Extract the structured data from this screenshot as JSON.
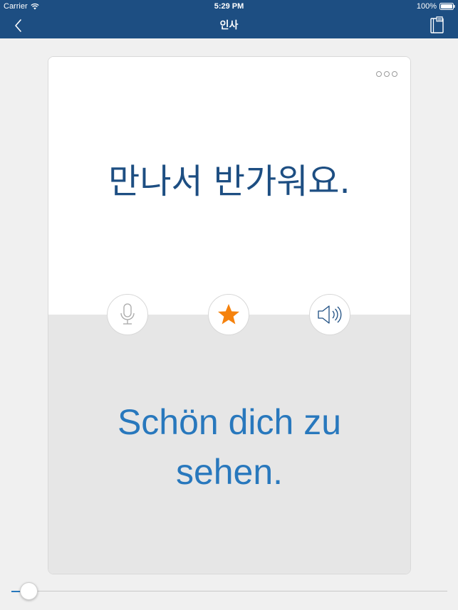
{
  "status_bar": {
    "carrier": "Carrier",
    "time": "5:29 PM",
    "battery": "100%"
  },
  "nav": {
    "title": "인사"
  },
  "card": {
    "phrase_korean": "만나서 반가워요.",
    "phrase_german": "Schön dich zu sehen."
  },
  "colors": {
    "brand_blue": "#1d4e82",
    "accent_blue": "#2878bd",
    "star_orange": "#f5820d"
  },
  "icons": {
    "back": "chevron-left-icon",
    "book": "book-icon",
    "more": "more-dots-icon",
    "mic": "microphone-icon",
    "star": "star-icon",
    "speaker": "speaker-icon"
  },
  "progress": {
    "slider_fraction": 0.04
  }
}
